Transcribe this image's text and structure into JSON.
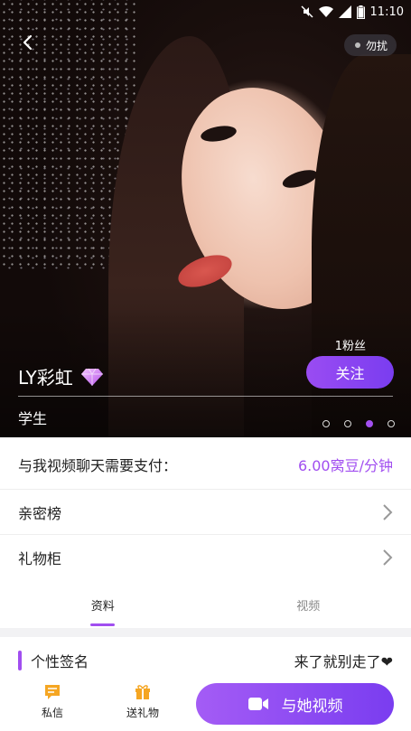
{
  "status_bar": {
    "time": "11:10"
  },
  "header": {
    "dnd_label": "勿扰"
  },
  "profile": {
    "fans": "1粉丝",
    "follow_label": "关注",
    "name": "LY彩虹",
    "occupation": "学生",
    "carousel": {
      "total": 4,
      "active_index": 2
    }
  },
  "pricing": {
    "label": "与我视频聊天需要支付：",
    "value": "6.00窝豆/分钟"
  },
  "menu": {
    "intimacy_label": "亲密榜",
    "gifts_label": "礼物柜"
  },
  "tabs": [
    {
      "label": "资料",
      "active": true
    },
    {
      "label": "视频",
      "active": false
    }
  ],
  "signature": {
    "title": "个性签名",
    "text": "来了就别走了❤"
  },
  "bottom_bar": {
    "message_label": "私信",
    "gift_label": "送礼物",
    "video_label": "与她视频"
  },
  "colors": {
    "accent": "#a14ef0",
    "accent_dark": "#7a3df0"
  }
}
